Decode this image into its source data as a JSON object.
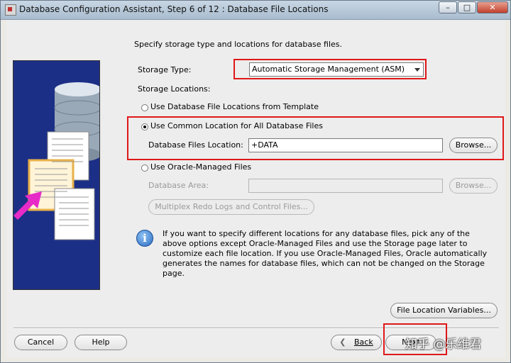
{
  "window": {
    "title": "Database Configuration Assistant, Step 6 of 12 : Database File Locations",
    "min_glyph": "–",
    "max_glyph": "□",
    "close_glyph": "✕"
  },
  "instruction": "Specify storage type and locations for database files.",
  "storage_type": {
    "label": "Storage Type:",
    "value": "Automatic Storage Management (ASM)"
  },
  "storage_locations_label": "Storage Locations:",
  "options": {
    "template": {
      "label": "Use Database File Locations from Template",
      "selected": false
    },
    "common": {
      "label": "Use Common Location for All Database Files",
      "selected": true,
      "field_label": "Database Files Location:",
      "field_value": "+DATA",
      "browse": "Browse..."
    },
    "omf": {
      "label": "Use Oracle-Managed Files",
      "selected": false,
      "area_label": "Database Area:",
      "area_value": "",
      "browse": "Browse...",
      "multiplex": "Multiplex Redo Logs and Control Files..."
    }
  },
  "info_text": "If you want to specify different locations for any database files, pick any of the above options except Oracle-Managed Files and use the Storage page later to customize each file location. If you use Oracle-Managed Files, Oracle automatically generates the names for database files, which can not be changed on the Storage page.",
  "file_location_variables": "File Location Variables...",
  "footer": {
    "cancel": "Cancel",
    "help": "Help",
    "back": "Back",
    "next": "Next",
    "back_glyph": "❮"
  },
  "watermark": "知乎 @乐维君",
  "colors": {
    "highlight": "#e01818",
    "illustration_bg": "#1c2f87",
    "arrow": "#e62bc8"
  }
}
